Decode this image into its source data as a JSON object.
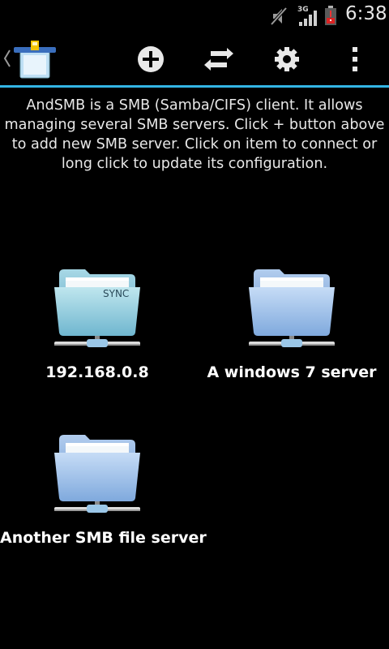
{
  "status_bar": {
    "network_type": "3G",
    "time": "6:38",
    "icons": [
      "mute-icon",
      "signal-icon",
      "battery-alert-icon"
    ]
  },
  "action_bar": {
    "icons": [
      "app-logo-icon",
      "add-icon",
      "swap-icon",
      "settings-icon",
      "overflow-menu-icon"
    ],
    "accent_color": "#33b5e5"
  },
  "description": "AndSMB is a SMB (Samba/CIFS) client. It allows managing several SMB servers. Click + button above to add new SMB server. Click on item to connect or long click to update its configuration.",
  "servers": [
    {
      "label": "192.168.0.8",
      "badge": "SYNC",
      "icon": "network-folder-sync-icon"
    },
    {
      "label": "A windows 7 server",
      "icon": "network-folder-icon"
    },
    {
      "label": "Another SMB file server",
      "icon": "network-folder-icon"
    }
  ]
}
